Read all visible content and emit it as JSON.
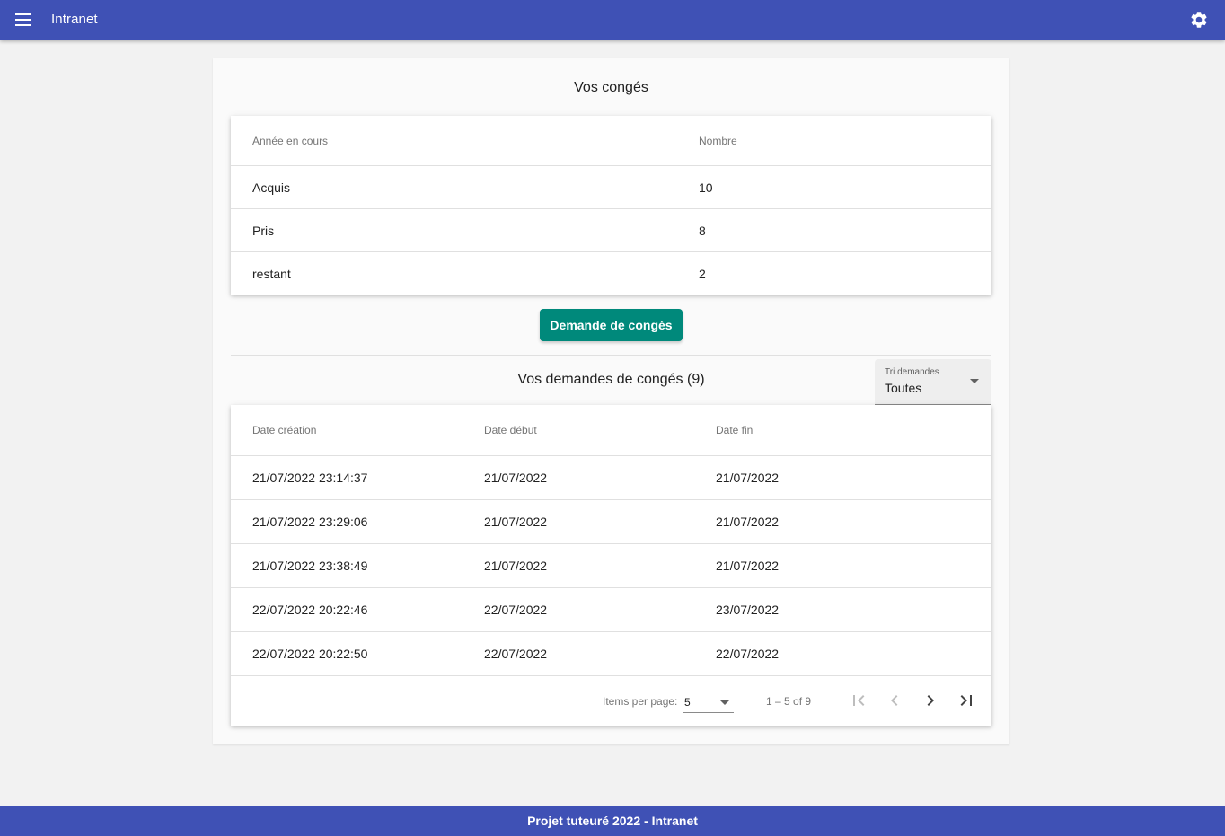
{
  "app": {
    "title": "Intranet",
    "menu_icon": "menu-icon",
    "settings_icon": "gear-icon"
  },
  "leave_summary": {
    "title": "Vos congés",
    "headers": [
      "Année en cours",
      "Nombre"
    ],
    "rows": [
      {
        "label": "Acquis",
        "value": "10"
      },
      {
        "label": "Pris",
        "value": "8"
      },
      {
        "label": "restant",
        "value": "2"
      }
    ]
  },
  "request_button": {
    "label": "Demande de congés"
  },
  "requests": {
    "title": "Vos demandes de congés (9)",
    "sort": {
      "label": "Tri demandes",
      "value": "Toutes"
    },
    "headers": [
      "Date création",
      "Date début",
      "Date fin"
    ],
    "rows": [
      {
        "created": "21/07/2022 23:14:37",
        "start": "21/07/2022",
        "end": "21/07/2022"
      },
      {
        "created": "21/07/2022 23:29:06",
        "start": "21/07/2022",
        "end": "21/07/2022"
      },
      {
        "created": "21/07/2022 23:38:49",
        "start": "21/07/2022",
        "end": "21/07/2022"
      },
      {
        "created": "22/07/2022 20:22:46",
        "start": "22/07/2022",
        "end": "23/07/2022"
      },
      {
        "created": "22/07/2022 20:22:50",
        "start": "22/07/2022",
        "end": "22/07/2022"
      }
    ],
    "paginator": {
      "items_per_page_label": "Items per page:",
      "items_per_page_value": "5",
      "range_label": "1 – 5 of 9"
    }
  },
  "footer": {
    "text": "Projet tuteuré 2022 - Intranet"
  },
  "colors": {
    "primary": "#3f51b5",
    "accent": "#00897b",
    "background": "#f2f2f2"
  }
}
